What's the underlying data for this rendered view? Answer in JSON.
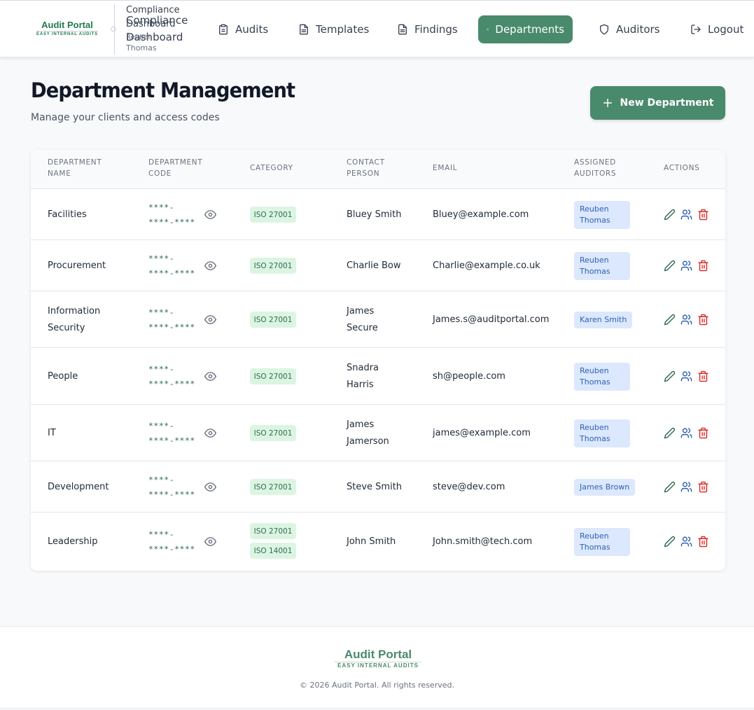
{
  "header": {
    "logo_main": "Audit Portal",
    "logo_sub": "EASY INTERNAL AUDITS",
    "brand_lines": [
      "Compliance",
      "Compliance",
      "Dashboard",
      "Dashboard",
      "Reuben",
      "Thomas"
    ],
    "nav": [
      {
        "label": "Audits",
        "icon": "clipboard-icon",
        "active": false
      },
      {
        "label": "Templates",
        "icon": "document-icon",
        "active": false
      },
      {
        "label": "Findings",
        "icon": "document-icon",
        "active": false
      },
      {
        "label": "Departments",
        "icon": "users-icon",
        "active": true
      },
      {
        "label": "Auditors",
        "icon": "shield-icon",
        "active": false
      },
      {
        "label": "Logout",
        "icon": "logout-icon",
        "active": false
      }
    ]
  },
  "page": {
    "title": "Department Management",
    "subtitle": "Manage your clients and access codes",
    "new_button": "New Department"
  },
  "table": {
    "columns": [
      "Department Name",
      "Department Code",
      "Category",
      "Contact Person",
      "Email",
      "Assigned Auditors",
      "Actions"
    ],
    "rows": [
      {
        "name": "Facilities",
        "code": "****-\n****-****",
        "categories": [
          "ISO 27001"
        ],
        "contact": "Bluey Smith",
        "email": "Bluey@example.com",
        "auditor": "Reuben Thomas"
      },
      {
        "name": "Procurement",
        "code": "****-\n****-****",
        "categories": [
          "ISO 27001"
        ],
        "contact": "Charlie Bow",
        "email": "Charlie@example.co.uk",
        "auditor": "Reuben Thomas"
      },
      {
        "name": "Information Security",
        "code": "****-\n****-****",
        "categories": [
          "ISO 27001"
        ],
        "contact": "James Secure",
        "email": "James.s@auditportal.com",
        "auditor": "Karen Smith"
      },
      {
        "name": "People",
        "code": "****-\n****-****",
        "categories": [
          "ISO 27001"
        ],
        "contact": "Snadra Harris",
        "email": "sh@people.com",
        "auditor": "Reuben Thomas"
      },
      {
        "name": "IT",
        "code": "****-\n****-****",
        "categories": [
          "ISO 27001"
        ],
        "contact": "James Jamerson",
        "email": "james@example.com",
        "auditor": "Reuben Thomas"
      },
      {
        "name": "Development",
        "code": "****-\n****-****",
        "categories": [
          "ISO 27001"
        ],
        "contact": "Steve Smith",
        "email": "steve@dev.com",
        "auditor": "James Brown"
      },
      {
        "name": "Leadership",
        "code": "****-\n****-****",
        "categories": [
          "ISO 27001",
          "ISO 14001"
        ],
        "contact": "John Smith",
        "email": "John.smith@tech.com",
        "auditor": "Reuben Thomas"
      }
    ]
  },
  "footer": {
    "logo_main": "Audit Portal",
    "logo_sub": "EASY INTERNAL AUDITS",
    "copyright": "© 2026 Audit Portal. All rights reserved."
  },
  "colors": {
    "brand_green": "#4a8a6c",
    "code_green": "#2f6b4f",
    "category_bg": "#dcf5e3",
    "auditor_bg": "#dbe8fd",
    "auditor_text": "#2f5fb5",
    "edit_icon": "#2f6b4f",
    "assign_icon": "#2f5fb5",
    "delete_icon": "#dc2626"
  }
}
